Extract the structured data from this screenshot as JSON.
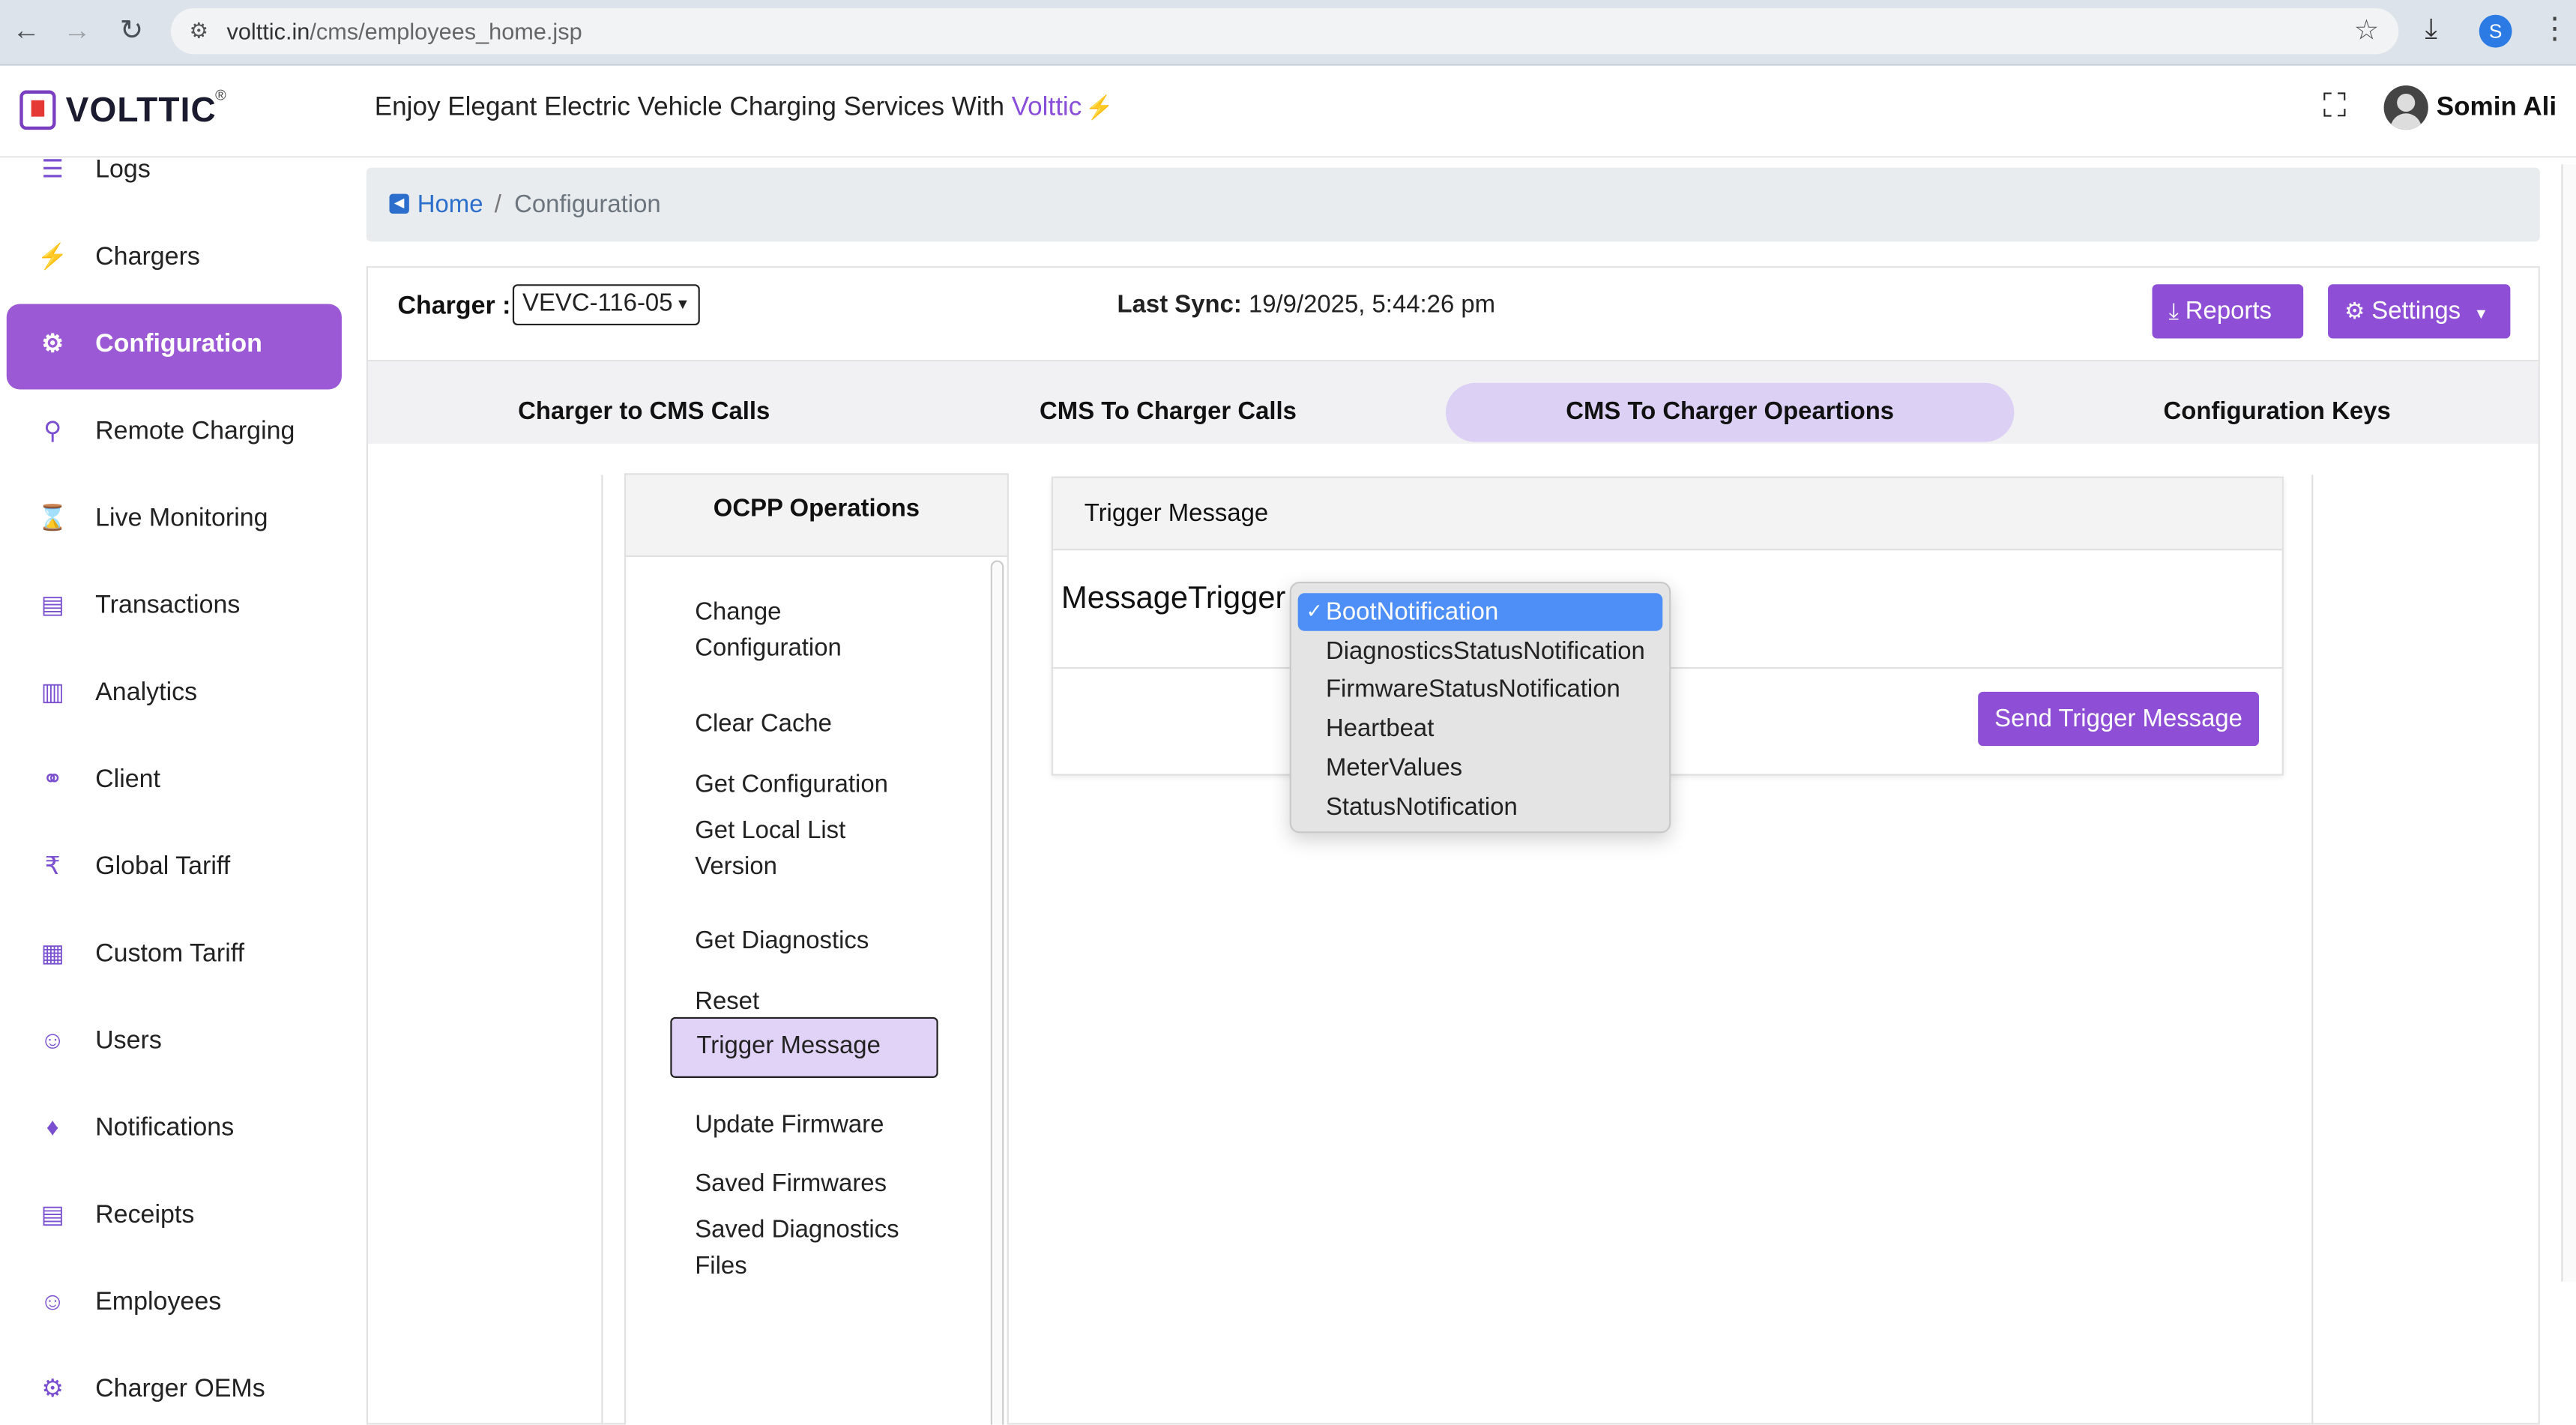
{
  "browser": {
    "url_host": "volttic.in",
    "url_path": "/cms/employees_home.jsp",
    "profile_initial": "S"
  },
  "header": {
    "logo_text": "VOLTTIC",
    "logo_reg": "®",
    "tagline": "Enjoy Elegant Electric Vehicle Charging Services With ",
    "tagline_brand": "Volttic",
    "user_name": "Somin Ali"
  },
  "sidebar": {
    "items": [
      {
        "label": "Logs",
        "icon": "logs-icon"
      },
      {
        "label": "Chargers",
        "icon": "charger-icon"
      },
      {
        "label": "Configuration",
        "icon": "gears-icon",
        "active": true
      },
      {
        "label": "Remote Charging",
        "icon": "plug-icon"
      },
      {
        "label": "Live Monitoring",
        "icon": "hourglass-icon"
      },
      {
        "label": "Transactions",
        "icon": "card-icon"
      },
      {
        "label": "Analytics",
        "icon": "bar-chart-icon"
      },
      {
        "label": "Client",
        "icon": "handshake-icon"
      },
      {
        "label": "Global Tariff",
        "icon": "rupee-icon"
      },
      {
        "label": "Custom Tariff",
        "icon": "custom-tariff-icon"
      },
      {
        "label": "Users",
        "icon": "users-icon"
      },
      {
        "label": "Notifications",
        "icon": "bell-icon"
      },
      {
        "label": "Receipts",
        "icon": "receipt-icon"
      },
      {
        "label": "Employees",
        "icon": "employees-icon"
      },
      {
        "label": "Charger OEMs",
        "icon": "oem-icon"
      }
    ]
  },
  "breadcrumb": {
    "home": "Home",
    "separator": "/",
    "current": "Configuration"
  },
  "toolbar": {
    "charger_label": "Charger :",
    "charger_value": "VEVC-116-05",
    "last_sync_label": "Last Sync:",
    "last_sync_value": " 19/9/2025, 5:44:26 pm",
    "reports_label": "Reports",
    "settings_label": "Settings"
  },
  "tabs": [
    {
      "label": "Charger to CMS Calls"
    },
    {
      "label": "CMS To Charger Calls"
    },
    {
      "label": "CMS To Charger Opeartions",
      "active": true
    },
    {
      "label": "Configuration Keys"
    }
  ],
  "ops": {
    "title": "OCPP Operations",
    "items": [
      {
        "label": "Change Configuration"
      },
      {
        "label": "Clear Cache"
      },
      {
        "label": "Get Configuration"
      },
      {
        "label": "Get Local List Version"
      },
      {
        "label": "Get Diagnostics"
      },
      {
        "label": "Reset"
      },
      {
        "label": "Trigger Message",
        "active": true
      },
      {
        "label": "Update Firmware"
      },
      {
        "label": "Saved Firmwares"
      },
      {
        "label": "Saved Diagnostics Files"
      }
    ]
  },
  "trigger": {
    "title": "Trigger Message",
    "field_label": "MessageTrigger :",
    "send_label": "Send Trigger Message",
    "options": [
      {
        "label": "BootNotification",
        "selected": true
      },
      {
        "label": "DiagnosticsStatusNotification"
      },
      {
        "label": "FirmwareStatusNotification"
      },
      {
        "label": "Heartbeat"
      },
      {
        "label": "MeterValues"
      },
      {
        "label": "StatusNotification"
      }
    ]
  },
  "colors": {
    "accent": "#8e4fd6",
    "active_sidebar": "#9b59d6",
    "active_tab": "#dcd0f5",
    "dropdown_selected": "#4e8ef7"
  }
}
